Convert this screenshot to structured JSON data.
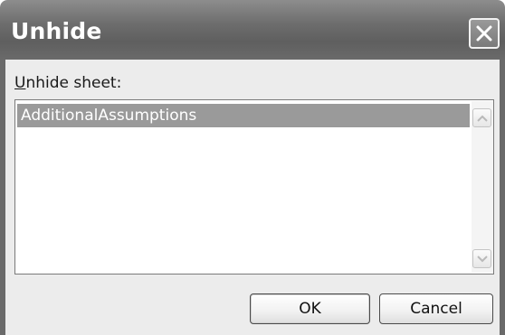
{
  "dialog": {
    "title": "Unhide",
    "close_icon": "close-icon"
  },
  "content": {
    "label_mnemonic": "U",
    "label_rest": "nhide sheet:",
    "sheets": [
      "AdditionalAssumptions"
    ],
    "selected_sheet": "AdditionalAssumptions"
  },
  "buttons": {
    "ok_label": "OK",
    "cancel_label": "Cancel"
  },
  "colors": {
    "titlebar": "#6d6d6d",
    "selection": "#9a9a9a",
    "dialog_bg": "#ececec"
  }
}
